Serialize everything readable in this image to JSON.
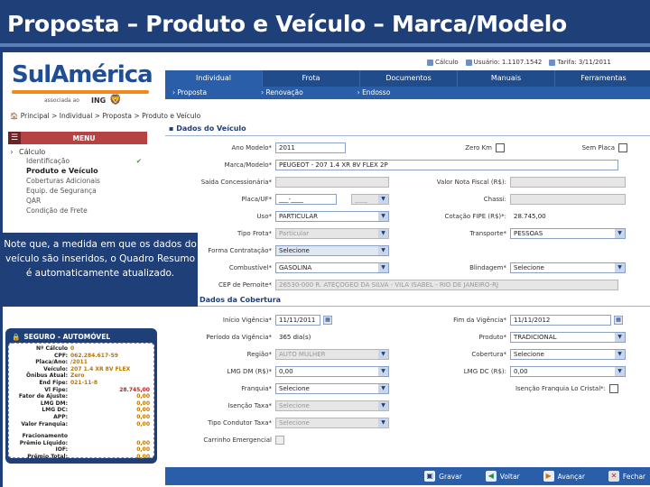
{
  "slide": {
    "title": "Proposta – Produto e Veículo – Marca/Modelo"
  },
  "logo": {
    "brand": "SulAmérica",
    "associated": "associada ao",
    "ing": "ING"
  },
  "status": {
    "calc": "Cálculo",
    "user": "Usuário: 1.1107.1542",
    "tarifa": "Tarifa: 3/11/2011"
  },
  "topnav": [
    "Individual",
    "Frota",
    "Documentos",
    "Manuais",
    "Ferramentas"
  ],
  "subnav": [
    "Proposta",
    "Renovação",
    "Endosso"
  ],
  "breadcrumb": "Principal > Individual > Proposta > Produto e Veículo",
  "menu": {
    "title": "MENU",
    "section": "Cálculo",
    "items": [
      {
        "label": "Identificação",
        "checked": true
      },
      {
        "label": "Produto e Veículo",
        "bold": true
      },
      {
        "label": "Coberturas Adicionais"
      },
      {
        "label": "Equip. de Segurança"
      },
      {
        "label": "QAR"
      },
      {
        "label": "Condição de Frete"
      }
    ]
  },
  "note": "Note que, a medida em que os dados do veículo são inseridos, o Quadro Resumo é automaticamente atualizado.",
  "summary": {
    "title": "SEGURO - AUTOMÓVEL",
    "rows": [
      {
        "label": "Nº Cálculo",
        "value": "0"
      },
      {
        "label": "CPF:",
        "value": "062.284.617-59"
      },
      {
        "label": "Placa/Ano:",
        "value": "/2011"
      },
      {
        "label": "Veículo:",
        "value": "207 1.4 XR 8V FLEX"
      },
      {
        "label": "Ônibus Atual:",
        "value": "Zero"
      },
      {
        "label": "End Fipe:",
        "value": "021-11-8"
      },
      {
        "label": "Vl Fipe:",
        "value": "28.745,00",
        "right": true,
        "red": true
      },
      {
        "label": "Fator de Ajuste:",
        "value": "0,00",
        "right": true
      },
      {
        "label": "LMG DM:",
        "value": "0,00",
        "right": true
      },
      {
        "label": "LMG DC:",
        "value": "0,00",
        "right": true
      },
      {
        "label": "APP:",
        "value": "0,00",
        "right": true
      },
      {
        "label": "Valor Franquia:",
        "value": "0,00",
        "right": true
      }
    ],
    "rows2": [
      {
        "label": "Fracionamento",
        "value": ""
      },
      {
        "label": "Prêmio Líquido:",
        "value": "0,00",
        "right": true
      },
      {
        "label": "IOF:",
        "value": "0,00",
        "right": true
      },
      {
        "label": "Prêmio Total:",
        "value": "0,00",
        "right": true
      }
    ]
  },
  "form": {
    "title": "Dados do Veículo",
    "title2": "Dados da Cobertura",
    "ano_modelo": {
      "label": "Ano Modelo*",
      "value": "2011"
    },
    "zero_km": {
      "label": "Zero Km"
    },
    "sem_placa": {
      "label": "Sem Placa"
    },
    "marca_modelo": {
      "label": "Marca/Modelo*",
      "value": "PEUGEOT - 207 1.4 XR 8V FLEX 2P"
    },
    "saida_conc": {
      "label": "Saída Concessionária*",
      "value": ""
    },
    "valor_nf": {
      "label": "Valor Nota Fiscal (R$):",
      "value": ""
    },
    "placa_uf": {
      "label": "Placa/UF*",
      "value": "___-____",
      "uf": "____"
    },
    "chassi": {
      "label": "Chassi:",
      "value": ""
    },
    "uso": {
      "label": "Uso*",
      "value": "PARTICULAR"
    },
    "cotacao_fipe": {
      "label": "Cotação FIPE (R$)*:",
      "value": "28.745,00"
    },
    "tipo_frota": {
      "label": "Tipo Frota*",
      "value": "Particular"
    },
    "transporte": {
      "label": "Transporte*",
      "value": "PESSOAS"
    },
    "forma_contratacao": {
      "label": "Forma Contratação*",
      "value": "Selecione"
    },
    "combustivel": {
      "label": "Combustível*",
      "value": "GASOLINA"
    },
    "blindagem": {
      "label": "Blindagem*",
      "value": "Selecione"
    },
    "cep_pernoite": {
      "label": "CEP de Pernoite*",
      "value": "26530-000 R. ATEÇOGEO DA SILVA - VILA ISABEL - RIO DE JANEIRO-RJ"
    },
    "inicio_vigencia": {
      "label": "Início Vigência*",
      "value": "11/11/2011"
    },
    "fim_vigencia": {
      "label": "Fim da Vigência*",
      "value": "11/11/2012"
    },
    "periodo_vigencia": {
      "label": "Período da Vigência*",
      "value": "365 dia(s)"
    },
    "produto": {
      "label": "Produto*",
      "value": "TRADICIONAL"
    },
    "regiao": {
      "label": "Região*",
      "value": "AUTO MULHER"
    },
    "cobertura": {
      "label": "Cobertura*",
      "value": "Selecione"
    },
    "lmg_dm": {
      "label": "LMG DM (R$)*",
      "value": "0,00"
    },
    "lmg_dc": {
      "label": "LMG DC (R$):",
      "value": "0,00"
    },
    "franquia": {
      "label": "Franquia*",
      "value": "Selecione"
    },
    "isencao_franquia": {
      "label": "Isenção Franquia Lo Cristal*:"
    },
    "isencao_taxa": {
      "label": "Isenção Taxa*",
      "value": "Selecione"
    },
    "tipo_condutor": {
      "label": "Tipo Condutor Taxa*",
      "value": "Selecione"
    },
    "carrinho_emergencial": {
      "label": "Carrinho Emergencial"
    }
  },
  "footer": {
    "save": "Gravar",
    "back": "Voltar",
    "next": "Avançar",
    "close": "Fechar"
  }
}
